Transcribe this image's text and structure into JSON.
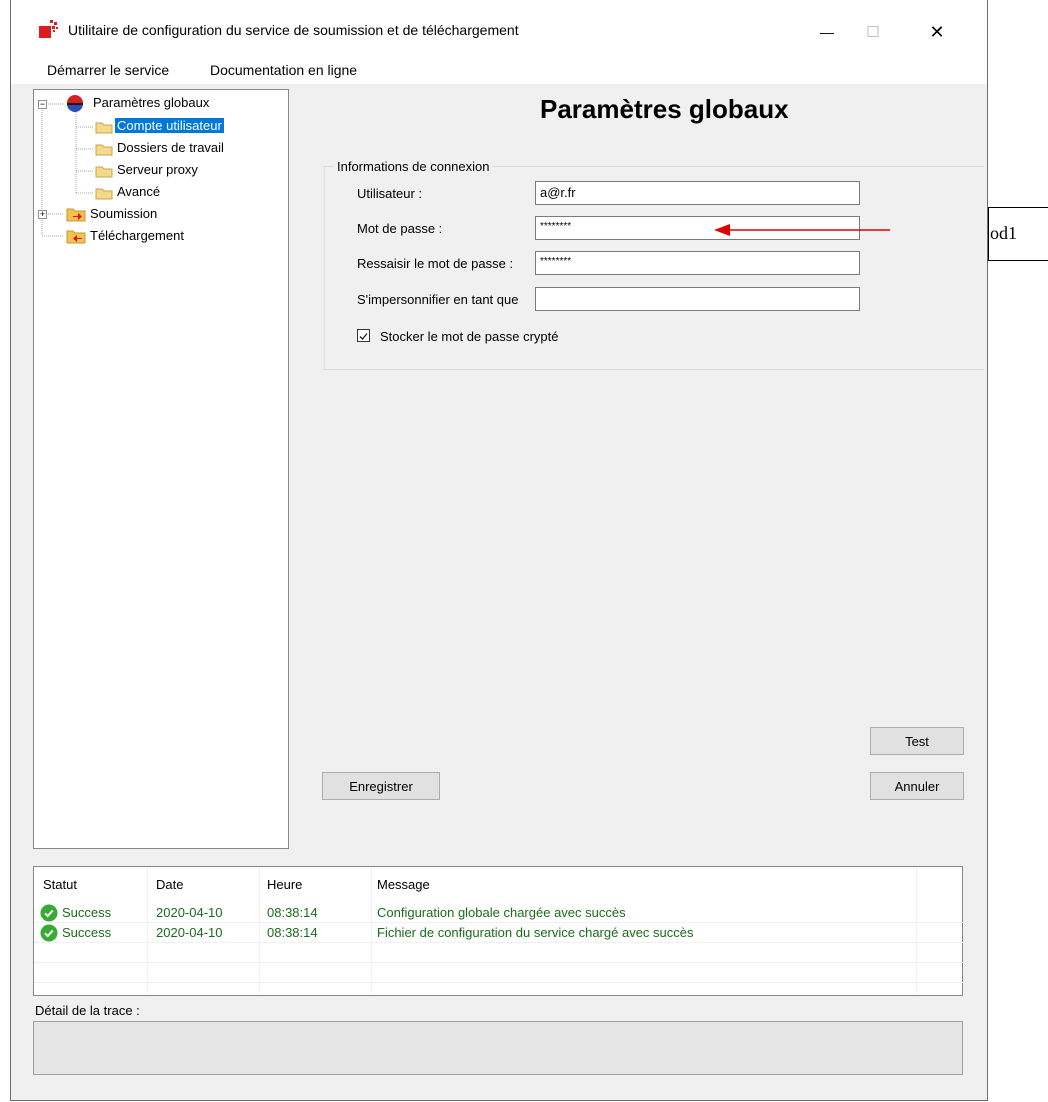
{
  "window": {
    "title": "Utilitaire de configuration du service de soumission et de téléchargement",
    "minimize": "—",
    "maximize": "☐",
    "close": "✕"
  },
  "menu": {
    "start_service": "Démarrer le service",
    "online_docs": "Documentation en ligne"
  },
  "tree": {
    "global": "Paramètres globaux",
    "user_account": "Compte utilisateur",
    "work_folders": "Dossiers de travail",
    "proxy_server": "Serveur proxy",
    "advanced": "Avancé",
    "submission": "Soumission",
    "download": "Téléchargement",
    "selected": "Compte utilisateur"
  },
  "main": {
    "page_title": "Paramètres globaux",
    "group_title": "Informations de connexion",
    "user_label": "Utilisateur :",
    "user_value": "a@r.fr",
    "password_label": "Mot de passe :",
    "password_value": "********",
    "confirm_label": "Ressaisir le mot de passe :",
    "confirm_value": "********",
    "impersonate_label": "S'impersonnifier en tant que",
    "impersonate_value": "",
    "store_encrypted_label": "Stocker le mot de passe crypté",
    "store_encrypted_checked": true,
    "test_button": "Test",
    "save_button": "Enregistrer",
    "cancel_button": "Annuler"
  },
  "log": {
    "headers": [
      "Statut",
      "Date",
      "Heure",
      "Message"
    ],
    "rows": [
      {
        "status": "Success",
        "date": "2020-04-10",
        "time": "08:38:14",
        "message": "Configuration globale chargée avec succès"
      },
      {
        "status": "Success",
        "date": "2020-04-10",
        "time": "08:38:14",
        "message": "Fichier de configuration du service chargé avec succès"
      }
    ],
    "trace_label": "Détail de la trace :",
    "trace_value": ""
  },
  "annotation": {
    "side_label": "od1",
    "arrow_color": "#e00000"
  },
  "colors": {
    "selection": "#0078d7",
    "success_text": "#1b6b1b",
    "success_icon": "#3aa935"
  }
}
